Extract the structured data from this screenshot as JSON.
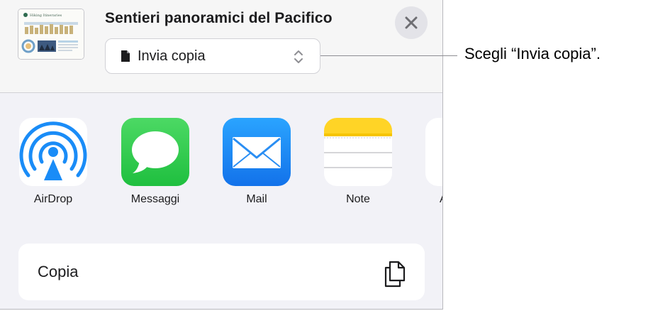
{
  "header": {
    "title": "Sentieri panoramici del Pacifico",
    "thumbnail_text": "Hiking Itineraries",
    "format_select": {
      "value": "Invia copia",
      "icon": "doc-icon"
    },
    "close_icon": "close-icon"
  },
  "callout": {
    "text": "Scegli “Invia copia”."
  },
  "apps": [
    {
      "label": "AirDrop",
      "icon": "airdrop-icon"
    },
    {
      "label": "Messaggi",
      "icon": "messages-icon"
    },
    {
      "label": "Mail",
      "icon": "mail-icon"
    },
    {
      "label": "Note",
      "icon": "notes-icon"
    },
    {
      "label": "A",
      "icon": "app-icon"
    }
  ],
  "actions": [
    {
      "label": "Copia",
      "icon": "copy-icon"
    }
  ],
  "colors": {
    "airdrop_blue": "#1a8cf7",
    "messages_green": "#33c84b",
    "mail_blue": "#1f86f5",
    "notes_yellow": "#ffd426",
    "sheet_bg": "#f2f2f7"
  }
}
